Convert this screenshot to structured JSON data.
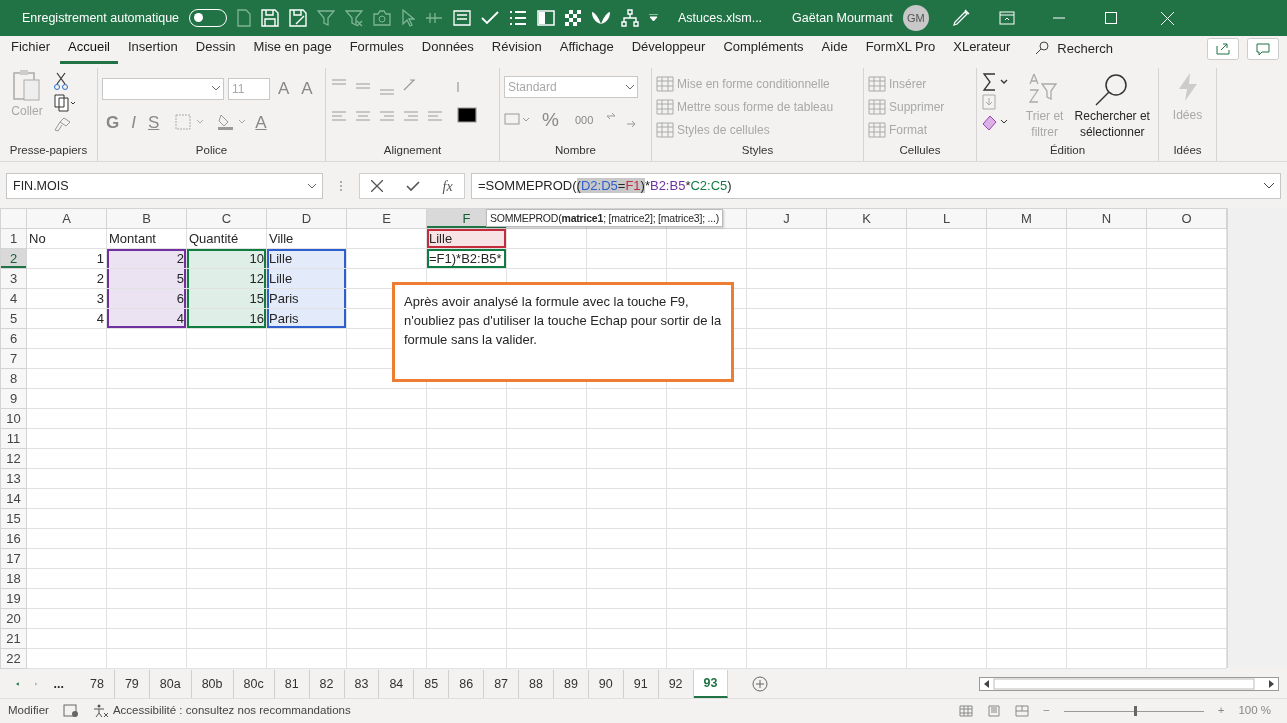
{
  "title_bar": {
    "autosave_label": "Enregistrement automatique",
    "autosave_on": false,
    "file_name": "Astuces.xlsm...",
    "user_name": "Gaëtan Mourmant",
    "avatar_initials": "GM"
  },
  "menu_tabs": [
    {
      "label": "Fichier",
      "selected": false
    },
    {
      "label": "Accueil",
      "selected": true
    },
    {
      "label": "Insertion",
      "selected": false
    },
    {
      "label": "Dessin",
      "selected": false
    },
    {
      "label": "Mise en page",
      "selected": false
    },
    {
      "label": "Formules",
      "selected": false
    },
    {
      "label": "Données",
      "selected": false
    },
    {
      "label": "Révision",
      "selected": false
    },
    {
      "label": "Affichage",
      "selected": false
    },
    {
      "label": "Développeur",
      "selected": false
    },
    {
      "label": "Compléments",
      "selected": false
    },
    {
      "label": "Aide",
      "selected": false
    },
    {
      "label": "FormXL Pro",
      "selected": false
    },
    {
      "label": "XLerateur",
      "selected": false
    }
  ],
  "search_label": "Recherch",
  "ribbon": {
    "clipboard": {
      "label": "Presse-papiers",
      "paste": {
        "text": "Coller",
        "disabled": true
      }
    },
    "font": {
      "label": "Police",
      "size": "11",
      "bold": "G",
      "italic": "I",
      "underline": "S",
      "grow": "A",
      "shrink": "A",
      "font_color_letter": "A"
    },
    "alignment": {
      "label": "Alignement"
    },
    "number": {
      "label": "Nombre",
      "format": "Standard",
      "percent": "%",
      "thousands": "000"
    },
    "styles": {
      "label": "Styles",
      "items": [
        {
          "text": "Mise en forme conditionnelle",
          "disabled": true
        },
        {
          "text": "Mettre sous forme de tableau",
          "disabled": true
        },
        {
          "text": "Styles de cellules",
          "disabled": true
        }
      ]
    },
    "cells": {
      "label": "Cellules",
      "items": [
        {
          "text": "Insérer",
          "disabled": true
        },
        {
          "text": "Supprimer",
          "disabled": true
        },
        {
          "text": "Format",
          "disabled": true
        }
      ]
    },
    "editing": {
      "label": "Édition",
      "sort": {
        "text": "Trier et filtrer",
        "disabled": true
      },
      "find": {
        "text": "Rechercher et sélectionner",
        "disabled": false
      }
    },
    "ideas": {
      "label": "Idées",
      "button": {
        "text": "Idées",
        "disabled": true
      }
    }
  },
  "formula_bar": {
    "name_box": "FIN.MOIS",
    "function_label": "fx",
    "segments": [
      {
        "text": "=SOMMEPROD(",
        "selected": false
      },
      {
        "text": "(",
        "selected": true
      },
      {
        "text": "D2:D5",
        "color": "#2e5fcf",
        "selected": true
      },
      {
        "text": "=",
        "selected": true
      },
      {
        "text": "F1",
        "color": "#c42b3c",
        "selected": true
      },
      {
        "text": ")",
        "selected": true
      },
      {
        "text": "*",
        "selected": false
      },
      {
        "text": "B2:B5",
        "color": "#7030a0",
        "selected": false
      },
      {
        "text": "*",
        "selected": false
      },
      {
        "text": "C2:C5",
        "color": "#107c41",
        "selected": false
      },
      {
        "text": ")",
        "selected": false
      }
    ]
  },
  "tooltip": "SOMMEPROD(**matrice1**; [matrice2]; [matrice3]; ...)",
  "grid": {
    "columns": [
      {
        "label": "A",
        "selected": false
      },
      {
        "label": "B",
        "selected": false
      },
      {
        "label": "C",
        "selected": false
      },
      {
        "label": "D",
        "selected": false
      },
      {
        "label": "E",
        "selected": false
      },
      {
        "label": "F",
        "selected": true
      },
      {
        "selected": false
      },
      {
        "selected": false
      },
      {
        "selected": false
      },
      {
        "label": "J",
        "selected": false
      },
      {
        "label": "K",
        "selected": false
      },
      {
        "label": "L",
        "selected": false
      },
      {
        "label": "M",
        "selected": false
      },
      {
        "label": "N",
        "selected": false
      },
      {
        "label": "O",
        "selected": false
      }
    ],
    "rows": [
      {
        "label": "1",
        "selected": false,
        "cells": [
          {
            "kind": "text",
            "text": "No"
          },
          {
            "kind": "text",
            "text": "Montant"
          },
          {
            "kind": "text",
            "text": "Quantité"
          },
          {
            "kind": "text",
            "text": "Ville"
          },
          null,
          {
            "kind": "text",
            "text": "Lille",
            "color": "#c42b3c"
          }
        ]
      },
      {
        "label": "2",
        "selected": true,
        "cells": [
          {
            "kind": "number",
            "text": "1"
          },
          {
            "kind": "number",
            "text": "2",
            "color": "#7030a0"
          },
          {
            "kind": "number",
            "text": "10",
            "color": "#107c41"
          },
          {
            "kind": "text",
            "text": "Lille",
            "color": "#2e5fcf"
          },
          null,
          {
            "kind": "edit",
            "text": "=F1)*B2:B5*",
            "color": "#107c41"
          }
        ]
      },
      {
        "label": "3",
        "selected": false,
        "cells": [
          {
            "kind": "number",
            "text": "2"
          },
          {
            "kind": "number",
            "text": "5",
            "color": "#7030a0"
          },
          {
            "kind": "number",
            "text": "12",
            "color": "#107c41"
          },
          {
            "kind": "text",
            "text": "Lille",
            "color": "#2e5fcf"
          }
        ]
      },
      {
        "label": "4",
        "selected": false,
        "cells": [
          {
            "kind": "number",
            "text": "3"
          },
          {
            "kind": "number",
            "text": "6",
            "color": "#7030a0"
          },
          {
            "kind": "number",
            "text": "15",
            "color": "#107c41"
          },
          {
            "kind": "text",
            "text": "Paris",
            "color": "#2e5fcf"
          }
        ]
      },
      {
        "label": "5",
        "selected": false,
        "cells": [
          {
            "kind": "number",
            "text": "4"
          },
          {
            "kind": "number",
            "text": "4",
            "color": "#7030a0"
          },
          {
            "kind": "number",
            "text": "16",
            "color": "#107c41"
          },
          {
            "kind": "text",
            "text": "Paris",
            "color": "#2e5fcf"
          }
        ]
      },
      {
        "label": "6",
        "selected": false
      },
      {
        "label": "7",
        "selected": false
      },
      {
        "label": "8",
        "selected": false
      },
      {
        "label": "9",
        "selected": false
      },
      {
        "label": "10",
        "selected": false
      },
      {
        "label": "11",
        "selected": false
      },
      {
        "label": "12",
        "selected": false
      },
      {
        "label": "13",
        "selected": false
      },
      {
        "label": "14",
        "selected": false
      },
      {
        "label": "15",
        "selected": false
      },
      {
        "label": "16",
        "selected": false
      },
      {
        "label": "17",
        "selected": false
      },
      {
        "label": "18",
        "selected": false
      },
      {
        "label": "19",
        "selected": false
      },
      {
        "label": "20",
        "selected": false
      },
      {
        "label": "21",
        "selected": false
      },
      {
        "label": "22",
        "selected": false
      }
    ]
  },
  "note": "Après avoir analysé la formule avec la touche F9, n'oubliez pas d'utiliser la touche Echap pour sortir de la formule sans la valider.",
  "sheet_more": "...",
  "sheets": [
    {
      "label": "78",
      "selected": false
    },
    {
      "label": "79",
      "selected": false
    },
    {
      "label": "80a",
      "selected": false
    },
    {
      "label": "80b",
      "selected": false
    },
    {
      "label": "80c",
      "selected": false
    },
    {
      "label": "81",
      "selected": false
    },
    {
      "label": "82",
      "selected": false
    },
    {
      "label": "83",
      "selected": false
    },
    {
      "label": "84",
      "selected": false
    },
    {
      "label": "85",
      "selected": false
    },
    {
      "label": "86",
      "selected": false
    },
    {
      "label": "87",
      "selected": false
    },
    {
      "label": "88",
      "selected": false
    },
    {
      "label": "89",
      "selected": false
    },
    {
      "label": "90",
      "selected": false
    },
    {
      "label": "91",
      "selected": false
    },
    {
      "label": "92",
      "selected": false
    },
    {
      "label": "93",
      "selected": true
    }
  ],
  "status_bar": {
    "mode": "Modifier",
    "accessibility": "Accessibilité : consultez nos recommandations",
    "zoom_out": "−",
    "zoom_in": "+",
    "zoom": "100 %",
    "zoom_slider": {
      "level": 0.5
    }
  }
}
